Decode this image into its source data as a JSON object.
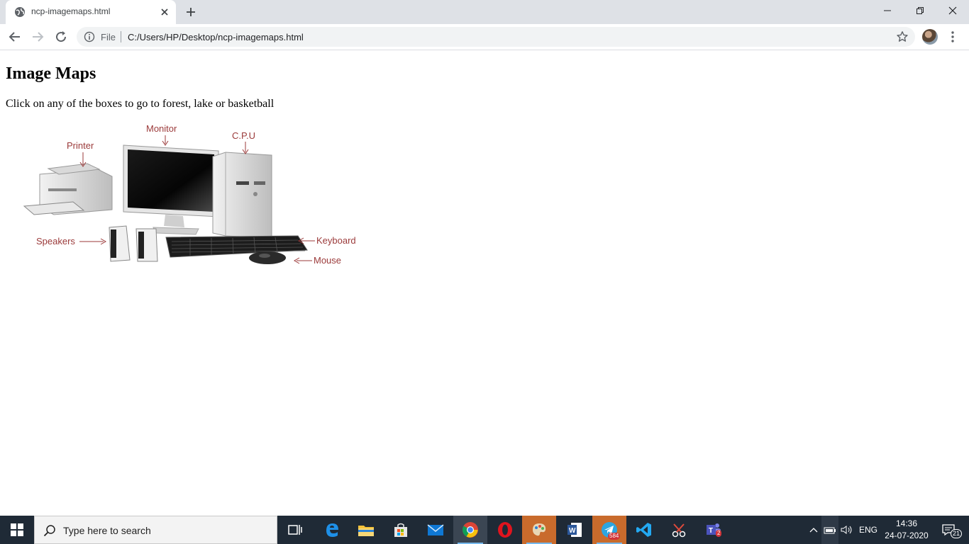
{
  "browser": {
    "tab": {
      "title": "ncp-imagemaps.html"
    },
    "address": {
      "scheme_label": "File",
      "url": "C:/Users/HP/Desktop/ncp-imagemaps.html"
    }
  },
  "page": {
    "heading": "Image Maps",
    "description": "Click on any of the boxes to go to forest, lake or basketball",
    "image_labels": {
      "monitor": "Monitor",
      "cpu": "C.P.U",
      "printer": "Printer",
      "speakers": "Speakers",
      "keyboard": "Keyboard",
      "mouse": "Mouse"
    }
  },
  "taskbar": {
    "search_placeholder": "Type here to search",
    "apps": [
      "task-view",
      "edge",
      "file-explorer",
      "microsoft-store",
      "mail",
      "chrome",
      "opera",
      "paint",
      "word",
      "telegram",
      "vscode",
      "snipping-tool",
      "teams"
    ],
    "telegram_badge": "584",
    "teams_badge": "2",
    "language": "ENG",
    "time": "14:36",
    "date": "24-07-2020",
    "notification_count": "21"
  },
  "colors": {
    "tabstrip": "#dee1e6",
    "omnibox": "#f1f3f4",
    "taskbar": "#1f2a36",
    "label_red": "#9b3a3a"
  }
}
